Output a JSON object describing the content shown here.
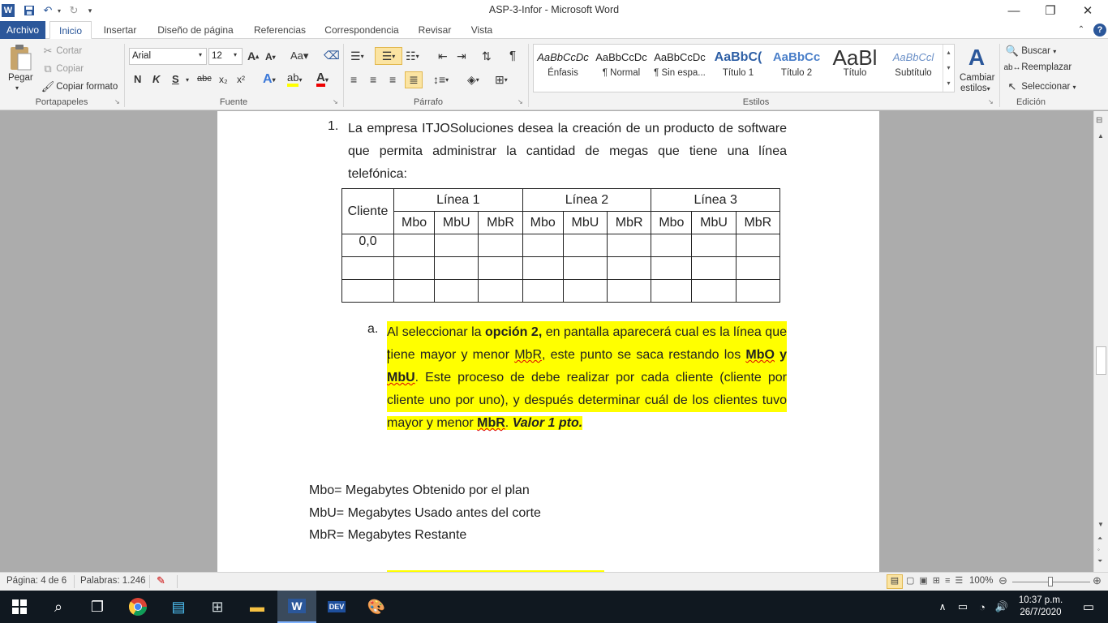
{
  "window": {
    "title": "ASP-3-Infor  -  Microsoft Word",
    "min": "—",
    "restore": "❐",
    "close": "✕"
  },
  "tabs": [
    "Archivo",
    "Inicio",
    "Insertar",
    "Diseño de página",
    "Referencias",
    "Correspondencia",
    "Revisar",
    "Vista"
  ],
  "ribbon": {
    "clipboard": {
      "paste": "Pegar",
      "cut": "Cortar",
      "copy": "Copiar",
      "format_painter": "Copiar formato",
      "label": "Portapapeles"
    },
    "font": {
      "name": "Arial",
      "size": "12",
      "label": "Fuente",
      "bold": "N",
      "italic": "K",
      "underline": "S",
      "strike": "abc",
      "sub": "x₂",
      "sup": "x²"
    },
    "paragraph": {
      "label": "Párrafo"
    },
    "styles": {
      "label": "Estilos",
      "items": [
        {
          "preview": "AaBbCcDc",
          "name": "Énfasis"
        },
        {
          "preview": "AaBbCcDc",
          "name": "¶ Normal"
        },
        {
          "preview": "AaBbCcDc",
          "name": "¶ Sin espa..."
        },
        {
          "preview": "AaBbC(",
          "name": "Título 1"
        },
        {
          "preview": "AaBbCc",
          "name": "Título 2"
        },
        {
          "preview": "AaBl",
          "name": "Título"
        },
        {
          "preview": "AaBbCcl",
          "name": "Subtítulo"
        }
      ],
      "change": "Cambiar",
      "change2": "estilos"
    },
    "editing": {
      "find": "Buscar",
      "replace": "Reemplazar",
      "select": "Seleccionar",
      "label": "Edición"
    }
  },
  "document": {
    "item1_num": "1.",
    "item1_lines": [
      "La empresa ITJOSoluciones desea la creación de un producto de software",
      "que permita administrar la cantidad de megas que tiene una línea",
      "telefónica:"
    ],
    "table": {
      "client_header": "Cliente",
      "groups": [
        "Línea 1",
        "Línea 2",
        "Línea 3"
      ],
      "subheaders": [
        "Mbo",
        "MbU",
        "MbR",
        "Mbo",
        "MbU",
        "MbR",
        "Mbo",
        "MbU",
        "MbR"
      ],
      "first_cell": "0,0"
    },
    "item_a": {
      "marker": "a.",
      "l1_a": "Al seleccionar la ",
      "l1_b": "opción 2,",
      "l1_c": " en pantalla aparecerá cual es la línea que",
      "l2_a": "tiene mayor y menor ",
      "l2_b": "MbR",
      "l2_c": ", este punto se saca restando los ",
      "l2_d": "MbO",
      "l2_e": " y",
      "l3_a": "MbU",
      "l3_b": ". Este proceso de debe realizar por cada cliente (cliente por",
      "l4": "cliente uno por uno), y después determinar cuál de los clientes tuvo",
      "l5_a": "mayor y menor ",
      "l5_b": "MbR",
      "l5_c": ". ",
      "l5_d": "Valor 1 pto."
    },
    "definitions": [
      "Mbo= Megabytes Obtenido por el plan",
      "MbU= Megabytes Usado antes del corte",
      "MbR= Megabytes Restante"
    ]
  },
  "statusbar": {
    "page": "Página: 4 de 6",
    "words": "Palabras: 1.246",
    "zoom": "100%"
  },
  "taskbar": {
    "time": "10:37 p.m.",
    "date": "26/7/2020"
  }
}
